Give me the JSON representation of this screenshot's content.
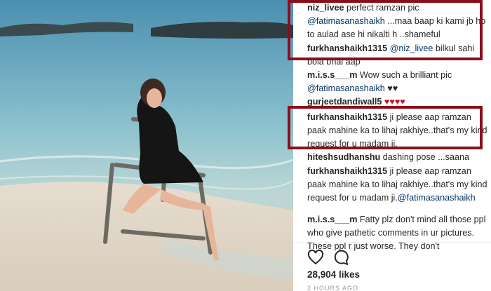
{
  "comments": [
    {
      "user": "niz_livee",
      "text": "perfect ramzan pic"
    },
    {
      "mention": "@fatimasanashaikh",
      "text": "...maa baap ki kami jb ho to aulad ase hi nikalti h ..shameful"
    },
    {
      "user": "furkhanshaikh1315",
      "mention": "@niz_livee",
      "text": "bilkul sahi bola bhai aap"
    },
    {
      "user": "m.i.s.s___m",
      "text": "Wow such a brilliant pic"
    },
    {
      "mention": "@fatimasanashaikh",
      "text": "♥♥"
    },
    {
      "user": "gurjeetdandiwall5",
      "text": "♥♥♥♥"
    },
    {
      "user": "furkhanshaikh1315",
      "text": "ji please aap ramzan paak mahine ka to lihaj rakhiye..that's my kind request for u madam ji."
    },
    {
      "user": "hiteshsudhanshu",
      "text": "dashing pose ...saana"
    },
    {
      "user": "furkhanshaikh1315",
      "text": "ji please aap ramzan paak mahine ka to lihaj rakhiye..that's my kind request for u madam ji.",
      "mention": "@fatimasanashaikh"
    },
    {
      "user": "m.i.s.s___m",
      "text": "Fatty plz don't mind all those ppl who give pathetic comments in ur pictures. These ppl r just worse. They don't"
    }
  ],
  "likes": "28,904 likes",
  "timestamp": "2 HOURS AGO",
  "icons": {
    "like": "heart-icon",
    "comment": "comment-icon"
  }
}
